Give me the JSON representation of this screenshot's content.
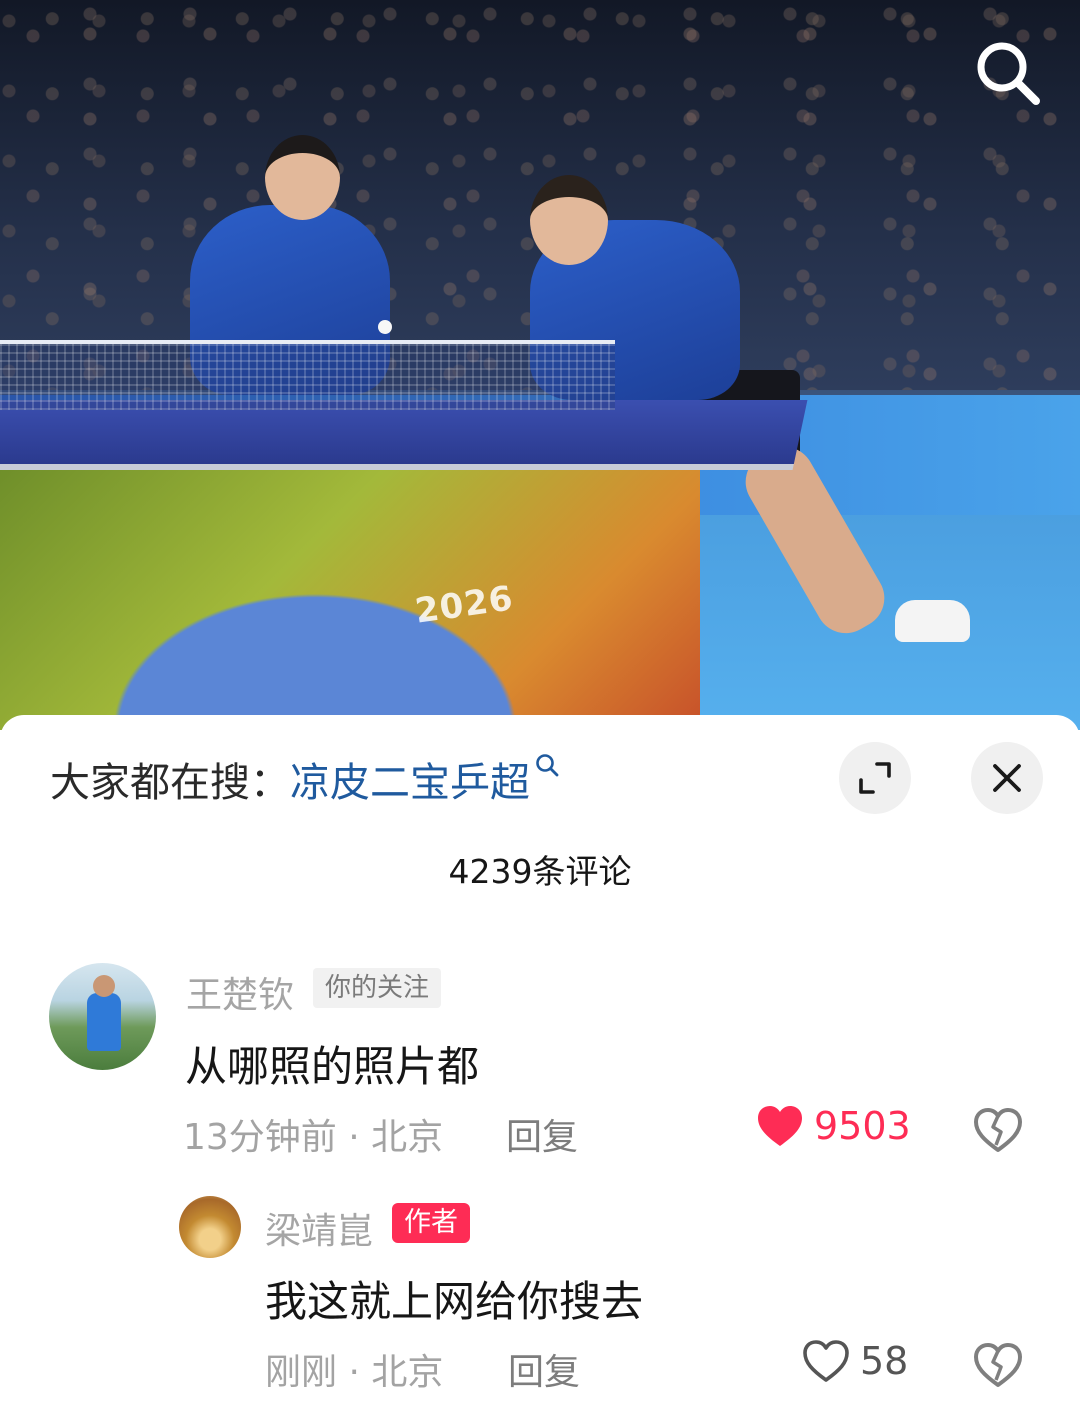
{
  "media": {
    "logo_text": "2026",
    "search_icon": "search-icon"
  },
  "trending": {
    "prefix": "大家都在搜：",
    "query": "凉皮二宝乒超",
    "icon": "search-small-icon"
  },
  "controls": {
    "expand_icon": "expand-icon",
    "close_icon": "close-icon"
  },
  "comments_header": {
    "count_label": "4239条评论"
  },
  "comments": [
    {
      "username": "王楚钦",
      "badge": "你的关注",
      "text": "从哪照的照片都",
      "meta": "13分钟前 · 北京",
      "reply_label": "回复",
      "likes": "9503",
      "liked": true
    },
    {
      "username": "梁靖崑",
      "badge": "作者",
      "text": "我这就上网给你搜去",
      "meta": "刚刚 · 北京",
      "reply_label": "回复",
      "likes": "58",
      "liked": false
    }
  ],
  "colors": {
    "accent_red": "#fe2c55",
    "query_blue": "#1f5a9e"
  }
}
